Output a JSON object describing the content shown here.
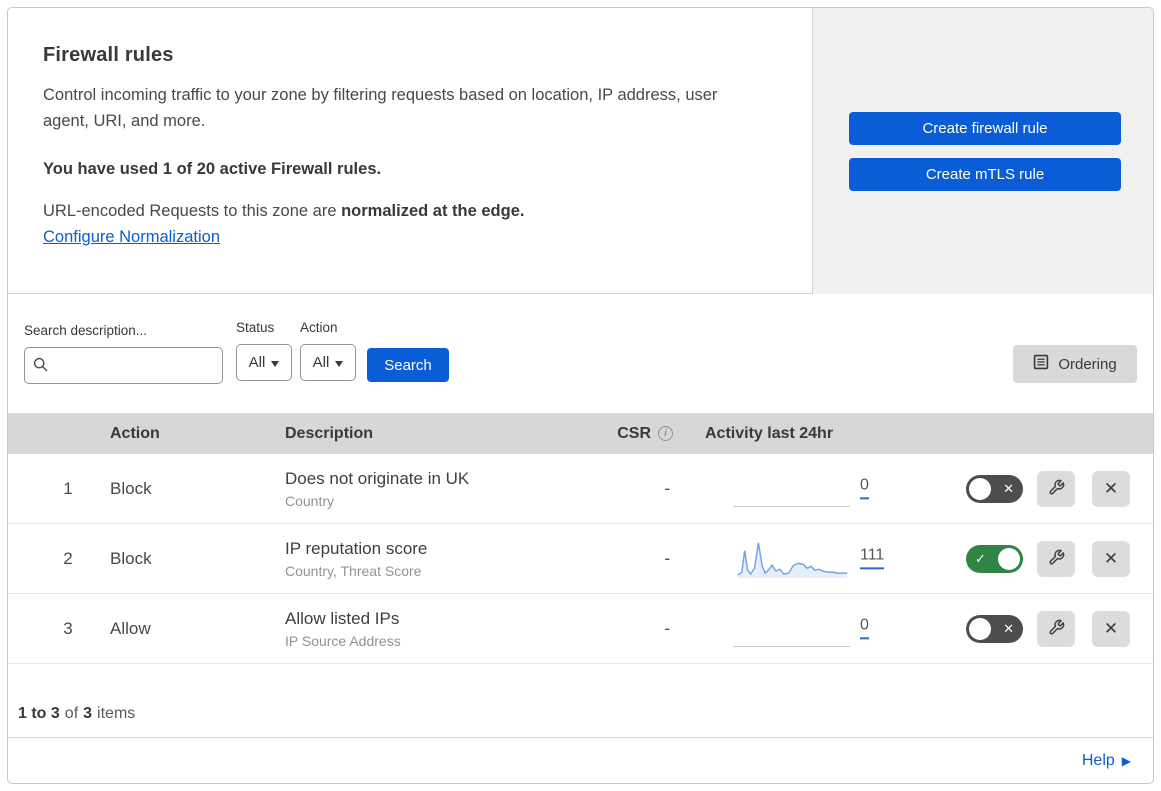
{
  "header": {
    "title": "Firewall rules",
    "description": "Control incoming traffic to your zone by filtering requests based on location, IP address, user agent, URI, and more.",
    "usage_line": "You have used 1 of 20 active Firewall rules.",
    "normalization_prefix": "URL-encoded Requests to this zone are ",
    "normalization_bold": "normalized at the edge.",
    "normalization_link": "Configure Normalization",
    "create_firewall_button": "Create firewall rule",
    "create_mtls_button": "Create mTLS rule"
  },
  "filters": {
    "search_label": "Search description...",
    "search_placeholder": "",
    "search_value": "",
    "status_label": "Status",
    "status_value": "All",
    "action_label": "Action",
    "action_value": "All",
    "search_button": "Search",
    "ordering_button": "Ordering"
  },
  "table": {
    "columns": {
      "action": "Action",
      "description": "Description",
      "csr": "CSR",
      "activity": "Activity last 24hr"
    },
    "rows": [
      {
        "index": "1",
        "action": "Block",
        "description": "Does not originate in UK",
        "criteria": "Country",
        "csr": "-",
        "activity_count": "0",
        "enabled": false
      },
      {
        "index": "2",
        "action": "Block",
        "description": "IP reputation score",
        "criteria": "Country, Threat Score",
        "csr": "-",
        "activity_count": "111",
        "enabled": true
      },
      {
        "index": "3",
        "action": "Allow",
        "description": "Allow listed IPs",
        "criteria": "IP Source Address",
        "csr": "-",
        "activity_count": "0",
        "enabled": false
      }
    ]
  },
  "sparkline": {
    "w": 112,
    "h": 40,
    "points": [
      [
        0,
        37
      ],
      [
        4,
        34
      ],
      [
        7,
        12
      ],
      [
        10,
        32
      ],
      [
        13,
        36
      ],
      [
        17,
        30
      ],
      [
        21,
        4
      ],
      [
        25,
        28
      ],
      [
        28,
        35
      ],
      [
        32,
        31
      ],
      [
        35,
        27
      ],
      [
        39,
        33
      ],
      [
        43,
        31
      ],
      [
        47,
        36
      ],
      [
        52,
        35
      ],
      [
        57,
        27
      ],
      [
        62,
        25
      ],
      [
        67,
        26
      ],
      [
        71,
        30
      ],
      [
        75,
        28
      ],
      [
        79,
        32
      ],
      [
        83,
        31
      ],
      [
        87,
        33
      ],
      [
        92,
        34
      ],
      [
        97,
        34
      ],
      [
        102,
        35
      ],
      [
        107,
        35
      ],
      [
        112,
        35
      ]
    ]
  },
  "footer": {
    "range": "1 to 3",
    "of": "of",
    "total": "3",
    "items": "items",
    "help": "Help"
  },
  "colors": {
    "accent_blue": "#0b5cd7",
    "toggle_on_green": "#2e8544",
    "toggle_off_gray": "#4d4d4f",
    "sparkline_stroke": "#74a3e3",
    "sparkline_fill": "rgba(116,163,227,0.18)",
    "count_underline_blue": "#2f6bc4"
  }
}
